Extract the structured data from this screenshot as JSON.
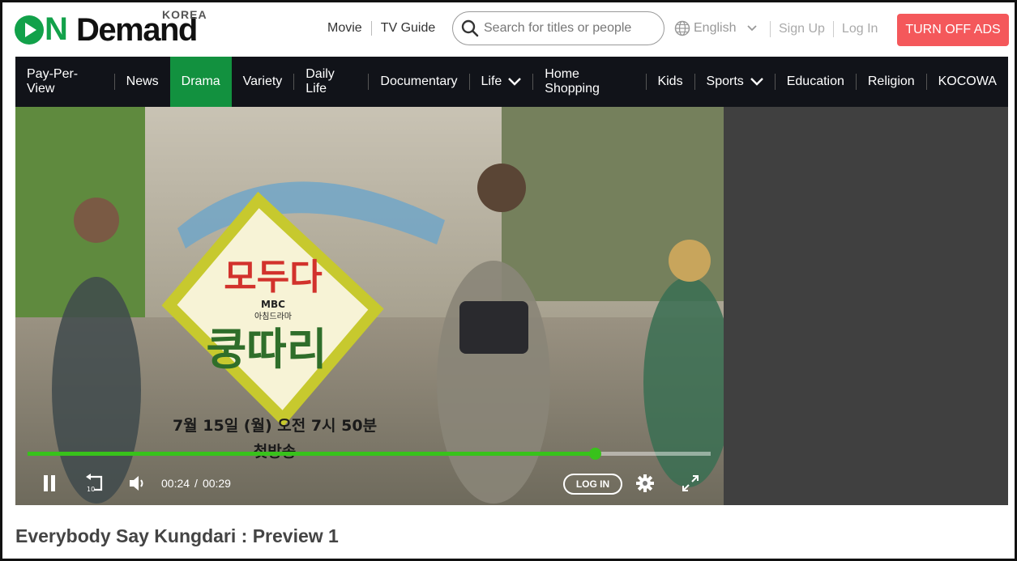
{
  "logo": {
    "on": "N",
    "demand": "Demand",
    "korea": "KOREA"
  },
  "top_links": [
    "Movie",
    "TV Guide"
  ],
  "search": {
    "placeholder": "Search for titles or people"
  },
  "language": {
    "selected": "English"
  },
  "auth": {
    "signup": "Sign Up",
    "login": "Log In"
  },
  "ads_button": "TURN OFF ADS",
  "nav": {
    "items": [
      {
        "label": "Pay-Per-View",
        "dropdown": false
      },
      {
        "label": "News",
        "dropdown": false
      },
      {
        "label": "Drama",
        "dropdown": false,
        "active": true
      },
      {
        "label": "Variety",
        "dropdown": false
      },
      {
        "label": "Daily Life",
        "dropdown": false
      },
      {
        "label": "Documentary",
        "dropdown": false
      },
      {
        "label": "Life",
        "dropdown": true
      },
      {
        "label": "Home Shopping",
        "dropdown": false
      },
      {
        "label": "Kids",
        "dropdown": false
      },
      {
        "label": "Sports",
        "dropdown": true
      },
      {
        "label": "Education",
        "dropdown": false
      },
      {
        "label": "Religion",
        "dropdown": false
      },
      {
        "label": "KOCOWA",
        "dropdown": false
      }
    ]
  },
  "player": {
    "show_logo_text": [
      "모두다",
      "쿵따리"
    ],
    "broadcaster": "MBC",
    "subtitle_small": "아침드라마",
    "airtime": "7월 15일 (월) 오전 7시 50분",
    "premiere": "첫방송",
    "current_time": "00:24",
    "duration": "00:29",
    "progress": 0.83,
    "login_label": "LOG IN"
  },
  "video_title": "Everybody Say Kungdari : Preview 1",
  "colors": {
    "brand_green": "#12a14a",
    "nav_bg": "#111319",
    "active_tab": "#12913f",
    "ads_red": "#f4585b",
    "progress": "#38c21b"
  }
}
